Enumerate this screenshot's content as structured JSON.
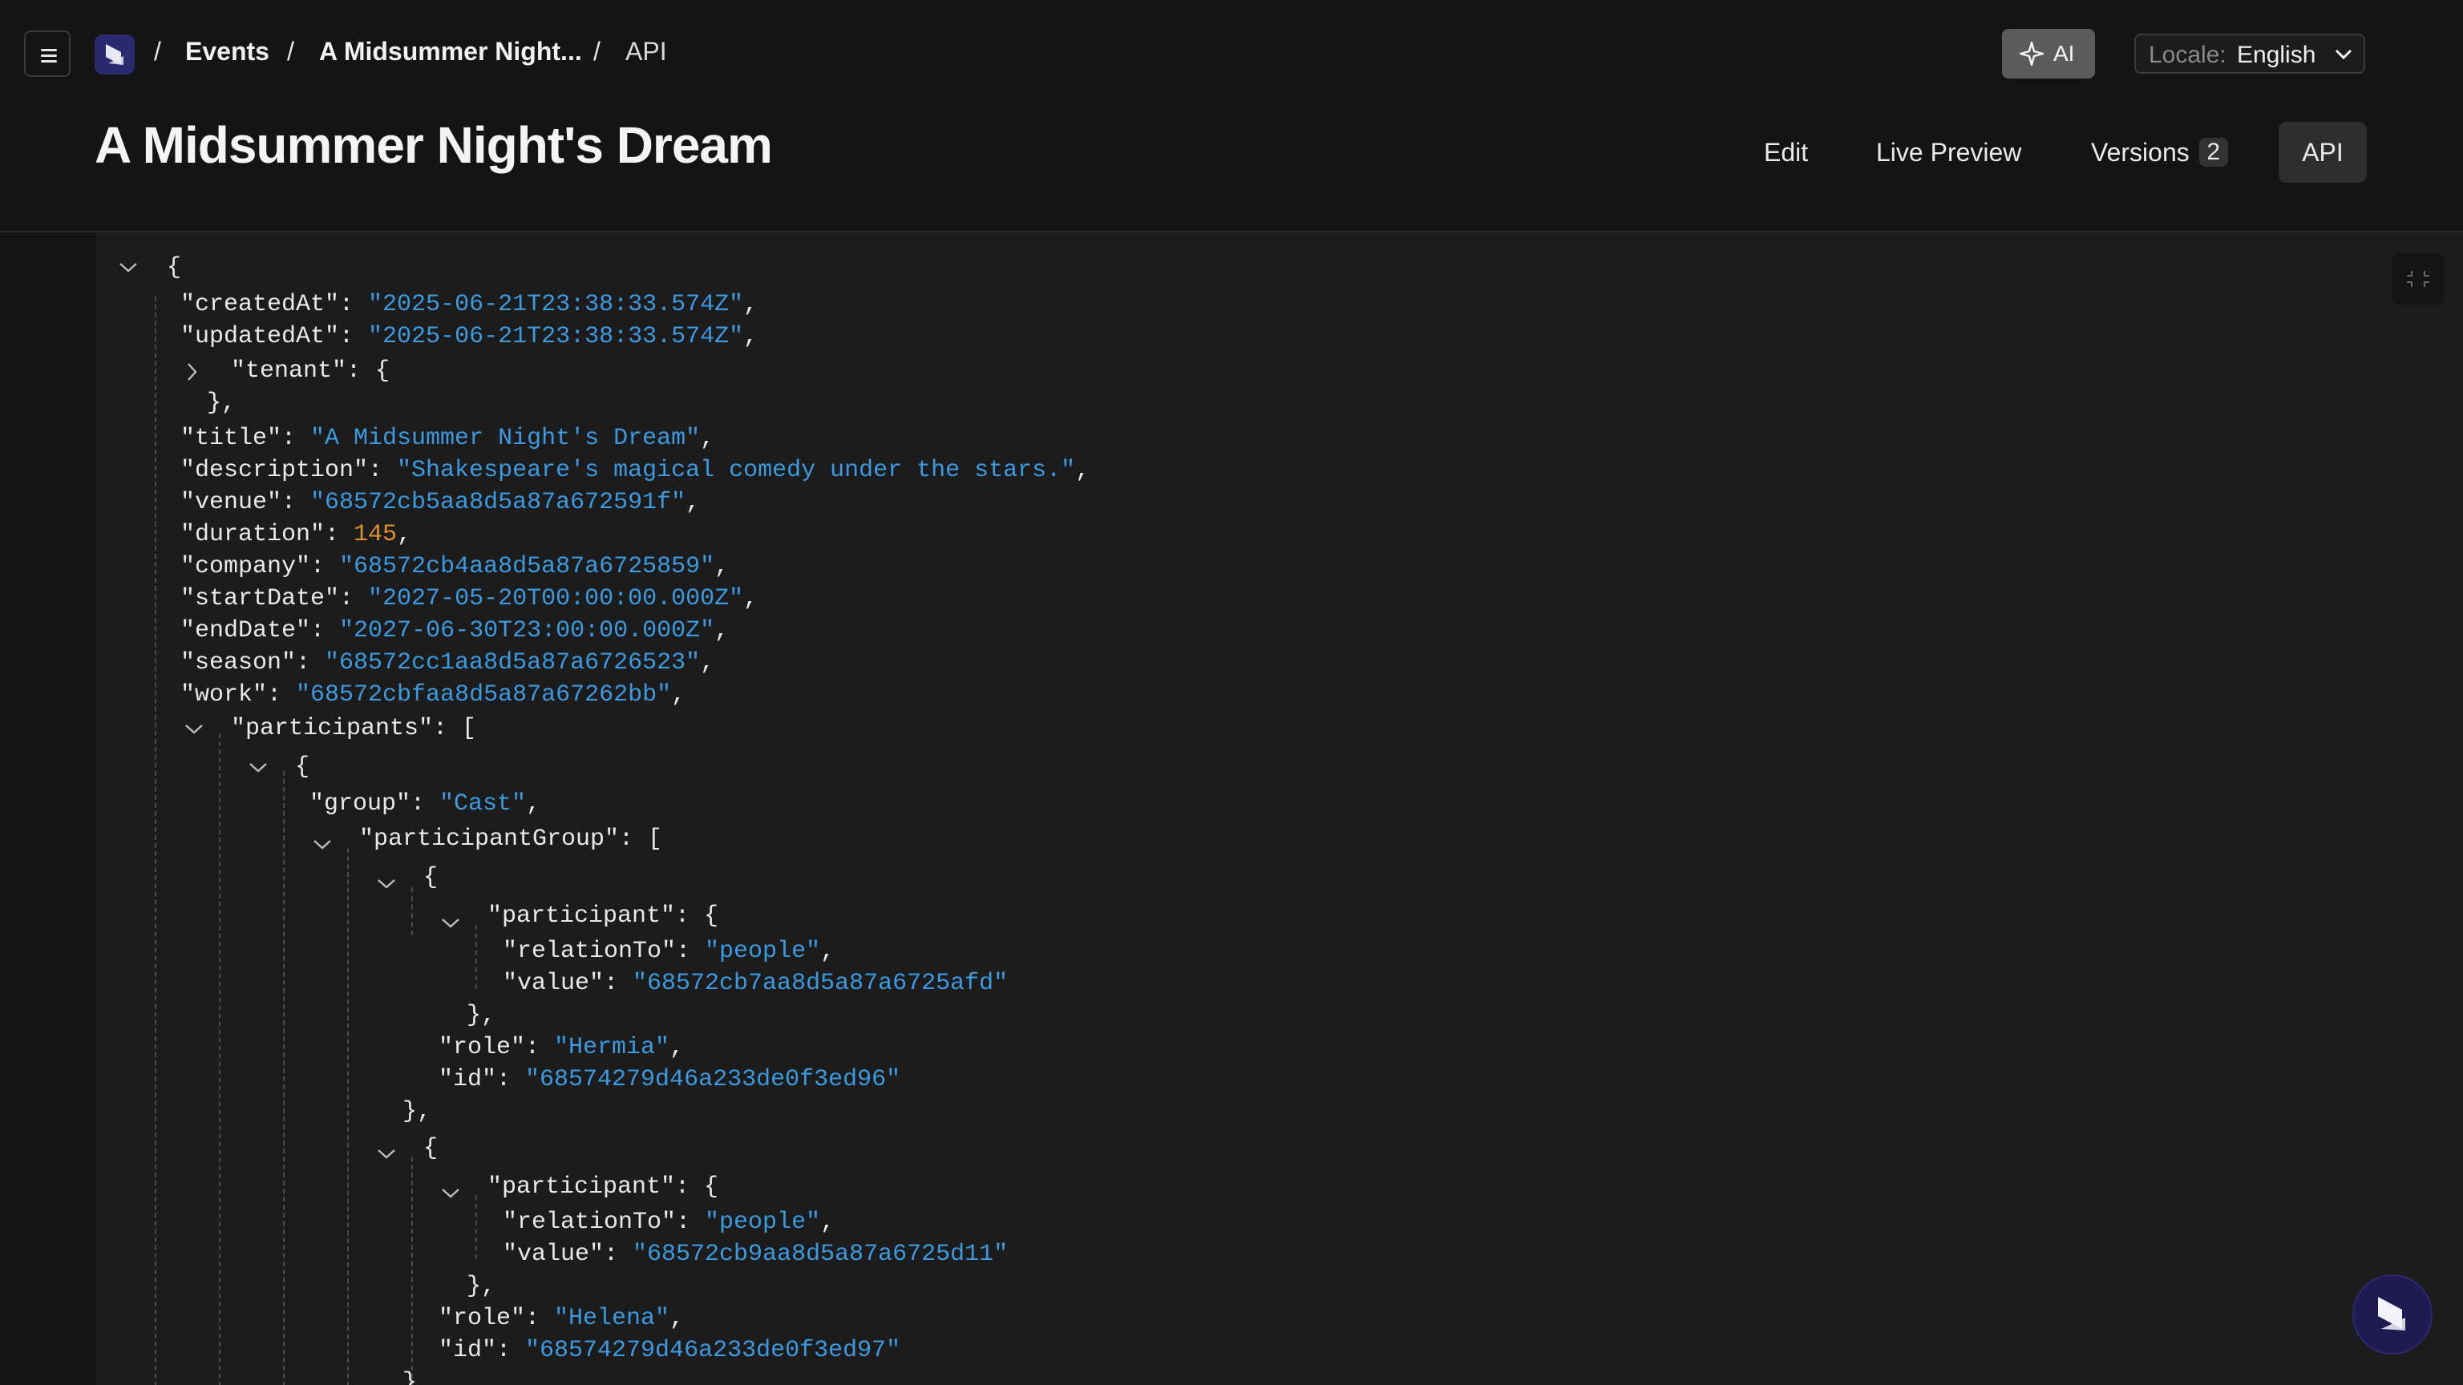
{
  "breadcrumb": {
    "items": [
      "Events",
      "A Midsummer Night..."
    ],
    "current": "API",
    "separator": "/"
  },
  "toolbar": {
    "ai_label": "AI",
    "locale_label": "Locale:",
    "locale_value": "English"
  },
  "page": {
    "title": "A Midsummer Night's Dream"
  },
  "tabs": [
    {
      "label": "Edit",
      "active": false
    },
    {
      "label": "Live Preview",
      "active": false
    },
    {
      "label": "Versions",
      "badge": "2",
      "active": false
    },
    {
      "label": "API",
      "active": true
    }
  ],
  "json_view": {
    "open_brace": "{",
    "createdAt": "\"2025-06-21T23:38:33.574Z\"",
    "updatedAt": "\"2025-06-21T23:38:33.574Z\"",
    "title": "\"A Midsummer Night's Dream\"",
    "description": "\"Shakespeare's magical comedy under the stars.\"",
    "venue": "\"68572cb5aa8d5a87a672591f\"",
    "duration": "145",
    "company": "\"68572cb4aa8d5a87a6725859\"",
    "startDate": "\"2027-05-20T00:00:00.000Z\"",
    "endDate": "\"2027-06-30T23:00:00.000Z\"",
    "season": "\"68572cc1aa8d5a87a6726523\"",
    "work": "\"68572cbfaa8d5a87a67262bb\"",
    "group": "\"Cast\"",
    "participants": [
      {
        "relationTo": "\"people\"",
        "value": "\"68572cb7aa8d5a87a6725afd\"",
        "role": "\"Hermia\"",
        "id": "\"68574279d46a233de0f3ed96\""
      },
      {
        "relationTo": "\"people\"",
        "value": "\"68572cb9aa8d5a87a6725d11\"",
        "role": "\"Helena\"",
        "id": "\"68574279d46a233de0f3ed97\""
      }
    ]
  }
}
